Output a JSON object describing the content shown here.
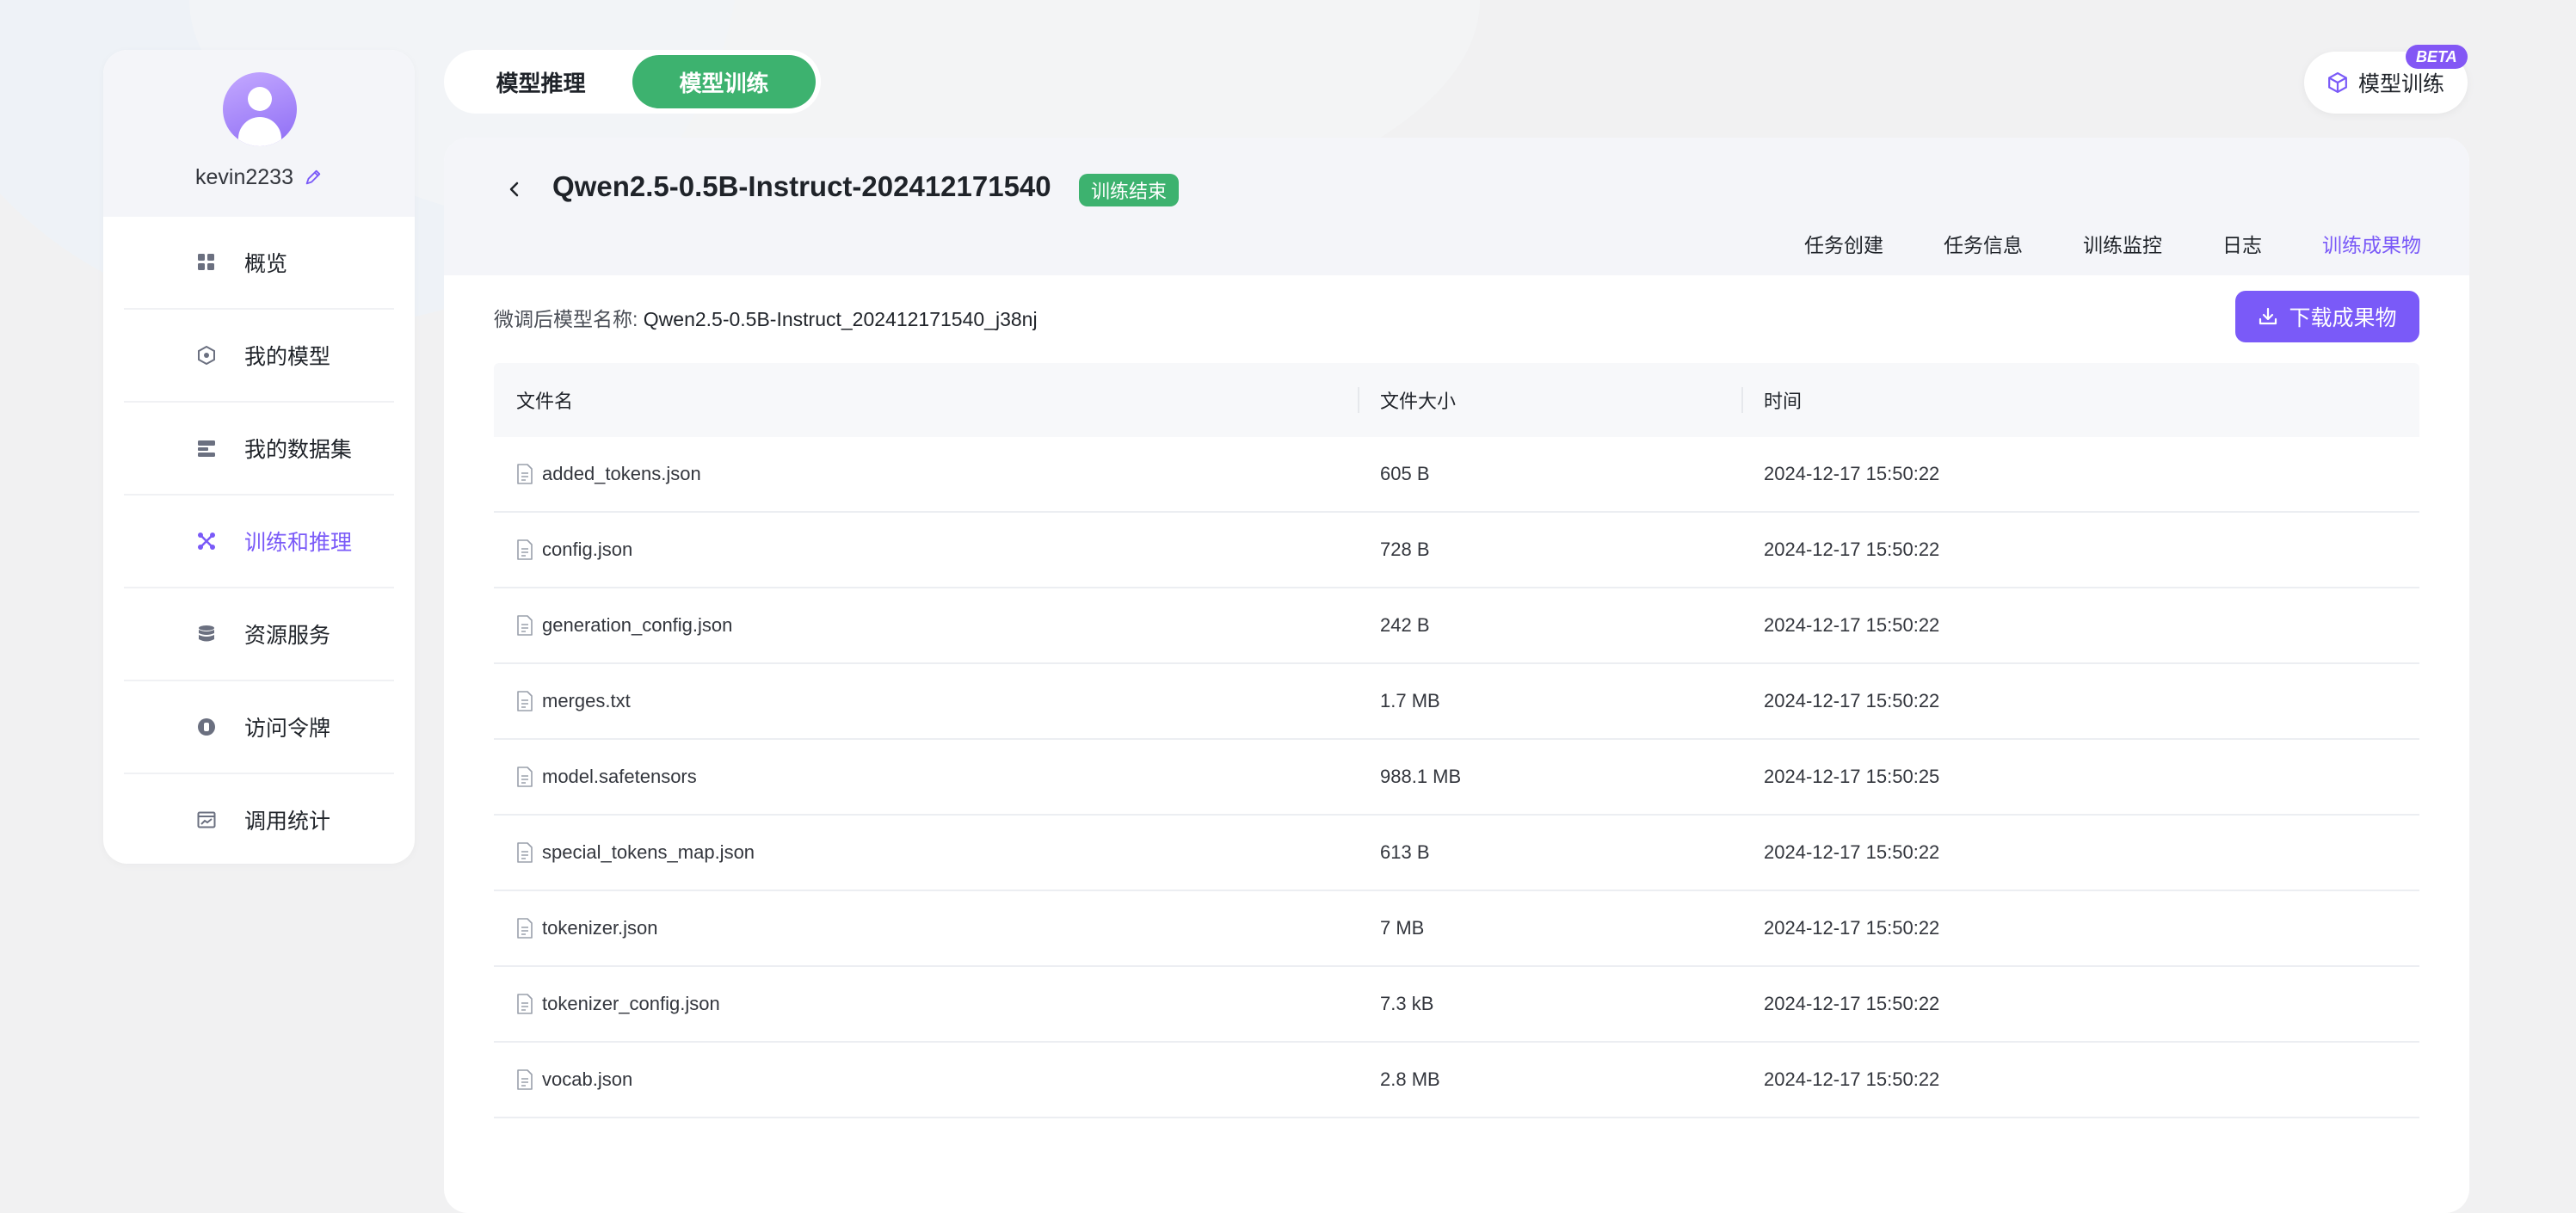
{
  "user": {
    "name": "kevin2233"
  },
  "sidebar": {
    "items": [
      {
        "label": "概览",
        "icon": "grid-icon",
        "active": false
      },
      {
        "label": "我的模型",
        "icon": "cube-icon",
        "active": false
      },
      {
        "label": "我的数据集",
        "icon": "dataset-icon",
        "active": false
      },
      {
        "label": "训练和推理",
        "icon": "train-icon",
        "active": true
      },
      {
        "label": "资源服务",
        "icon": "database-icon",
        "active": false
      },
      {
        "label": "访问令牌",
        "icon": "token-icon",
        "active": false
      },
      {
        "label": "调用统计",
        "icon": "stats-icon",
        "active": false
      }
    ]
  },
  "mode_tabs": [
    {
      "label": "模型推理",
      "active": false
    },
    {
      "label": "模型训练",
      "active": true
    }
  ],
  "top_right": {
    "label": "模型训练",
    "badge": "BETA"
  },
  "job": {
    "title": "Qwen2.5-0.5B-Instruct-202412171540",
    "status": "训练结束"
  },
  "sub_tabs": [
    {
      "label": "任务创建",
      "active": false
    },
    {
      "label": "任务信息",
      "active": false
    },
    {
      "label": "训练监控",
      "active": false
    },
    {
      "label": "日志",
      "active": false
    },
    {
      "label": "训练成果物",
      "active": true
    }
  ],
  "model_name": {
    "label": "微调后模型名称:",
    "value": "Qwen2.5-0.5B-Instruct_202412171540_j38nj"
  },
  "download_button": "下载成果物",
  "table": {
    "headers": [
      "文件名",
      "文件大小",
      "时间"
    ],
    "rows": [
      {
        "name": "added_tokens.json",
        "size": "605 B",
        "time": "2024-12-17 15:50:22"
      },
      {
        "name": "config.json",
        "size": "728 B",
        "time": "2024-12-17 15:50:22"
      },
      {
        "name": "generation_config.json",
        "size": "242 B",
        "time": "2024-12-17 15:50:22"
      },
      {
        "name": "merges.txt",
        "size": "1.7 MB",
        "time": "2024-12-17 15:50:22"
      },
      {
        "name": "model.safetensors",
        "size": "988.1 MB",
        "time": "2024-12-17 15:50:25"
      },
      {
        "name": "special_tokens_map.json",
        "size": "613 B",
        "time": "2024-12-17 15:50:22"
      },
      {
        "name": "tokenizer.json",
        "size": "7 MB",
        "time": "2024-12-17 15:50:22"
      },
      {
        "name": "tokenizer_config.json",
        "size": "7.3 kB",
        "time": "2024-12-17 15:50:22"
      },
      {
        "name": "vocab.json",
        "size": "2.8 MB",
        "time": "2024-12-17 15:50:22"
      }
    ]
  },
  "colors": {
    "accent": "#7a5af8",
    "success": "#3db26f"
  }
}
